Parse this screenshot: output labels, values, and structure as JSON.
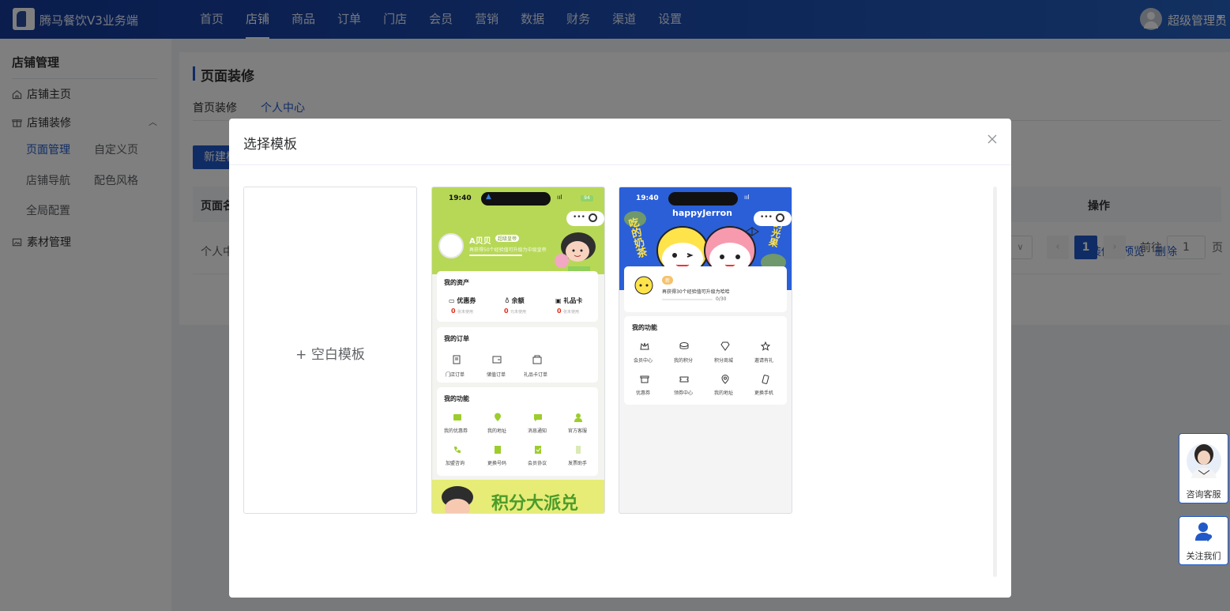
{
  "app": {
    "title": "腾马餐饮V3业务端"
  },
  "nav": {
    "items": [
      "首页",
      "店铺",
      "商品",
      "订单",
      "门店",
      "会员",
      "营销",
      "数据",
      "财务",
      "渠道",
      "设置"
    ],
    "active_index": 1
  },
  "user": {
    "name": "超级管理员"
  },
  "sidebar": {
    "title": "店铺管理",
    "shop_home": "店铺主页",
    "decoration": "店铺装修",
    "sub_items": [
      "页面管理",
      "自定义页",
      "店铺导航",
      "配色风格",
      "全局配置"
    ],
    "active_sub": "页面管理",
    "materials": "素材管理"
  },
  "main": {
    "page_title": "页面装修",
    "tabs": [
      "首页装修",
      "个人中心"
    ],
    "active_tab": "个人中心",
    "new_button": "新建模",
    "table": {
      "headers": [
        "页面名",
        "操作"
      ],
      "rows": [
        {
          "name": "个人中",
          "actions": [
            "装修",
            "预览",
            "删除"
          ]
        }
      ]
    },
    "pagination": {
      "current_page": "1",
      "goto_label": "前往",
      "goto_value": "1",
      "page_label": "页"
    }
  },
  "float_buttons": {
    "consult": "咨询客服",
    "follow": "关注我们"
  },
  "modal": {
    "title": "选择模板",
    "blank_template": "+ 空白模板",
    "templates": [
      {
        "status_time": "19:40",
        "battery": "94",
        "user_name": "A贝贝",
        "badge": "超级皇帝",
        "progress_text": "再获得50个经验值可升级为中级皇帝",
        "assets_title": "我的资产",
        "assets": [
          {
            "label": "优惠券",
            "value": "0",
            "unit": "张未使用"
          },
          {
            "label": "余额",
            "value": "0",
            "unit": "元未使用"
          },
          {
            "label": "礼品卡",
            "value": "0",
            "unit": "张未使用"
          }
        ],
        "orders_title": "我的订单",
        "orders": [
          "门店订单",
          "储值订单",
          "礼品卡订单"
        ],
        "functions_title": "我的功能",
        "functions": [
          "我的优惠券",
          "我的地址",
          "消息通知",
          "官方客服",
          "加盟咨询",
          "更换号码",
          "会员协议",
          "发票助手"
        ],
        "banner_text": "积分大派兑"
      },
      {
        "status_time": "19:40",
        "brand": "happyJerron",
        "side_text_left": "吃的奶茶",
        "side_text_right": "的光果",
        "badge": "新",
        "progress_text": "再获得30个经验值可升级为哈哈",
        "progress_value": "0/30",
        "functions_title": "我的功能",
        "functions": [
          "会员中心",
          "我的积分",
          "积分商城",
          "邀请有礼",
          "优惠券",
          "领券中心",
          "我的地址",
          "更换手机"
        ]
      }
    ]
  },
  "colors": {
    "primary": "#2159c9",
    "header": "#1d4fb3",
    "template_green": "#b7d857",
    "template_blue": "#2a5fd8",
    "price_red": "#e0301e"
  }
}
